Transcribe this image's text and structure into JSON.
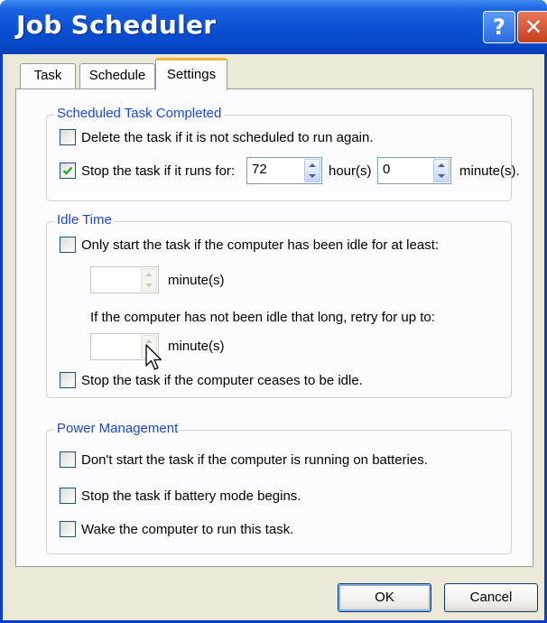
{
  "window": {
    "title": "Job Scheduler",
    "help_glyph": "?",
    "close_glyph": "✕"
  },
  "tabs": [
    {
      "label": "Task",
      "active": false
    },
    {
      "label": "Schedule",
      "active": false
    },
    {
      "label": "Settings",
      "active": true
    }
  ],
  "scheduled_task_completed": {
    "legend": "Scheduled Task Completed",
    "delete_task": {
      "label": "Delete the task if it is not scheduled to run again.",
      "checked": false
    },
    "stop_task": {
      "label": "Stop the task if it runs for:",
      "checked": true,
      "hours_value": "72",
      "hours_label": "hour(s)",
      "minutes_value": "0",
      "minutes_label": "minute(s)."
    }
  },
  "idle_time": {
    "legend": "Idle Time",
    "only_start_idle": {
      "label": "Only start the task if the computer has been idle for at least:",
      "checked": false
    },
    "idle_minutes_value": "",
    "idle_minutes_label": "minute(s)",
    "retry_text": "If the computer has not been idle that long, retry for up to:",
    "retry_minutes_value": "",
    "retry_minutes_label": "minute(s)",
    "stop_if_not_idle": {
      "label": "Stop the task if the computer ceases to be idle.",
      "checked": false
    }
  },
  "power_management": {
    "legend": "Power Management",
    "no_start_batteries": {
      "label": "Don't start the task if the computer is running on batteries.",
      "checked": false
    },
    "stop_battery_mode": {
      "label": "Stop the task if battery mode begins.",
      "checked": false
    },
    "wake_computer": {
      "label": "Wake the computer to run this task.",
      "checked": false
    }
  },
  "buttons": {
    "ok": "OK",
    "cancel": "Cancel"
  },
  "colors": {
    "titlebar": "#0a4fd3",
    "legend_text": "#1a48d6",
    "dialog_bg": "#ece9d8",
    "panel_bg": "#fcfcfe",
    "check_mark": "#21a121"
  }
}
